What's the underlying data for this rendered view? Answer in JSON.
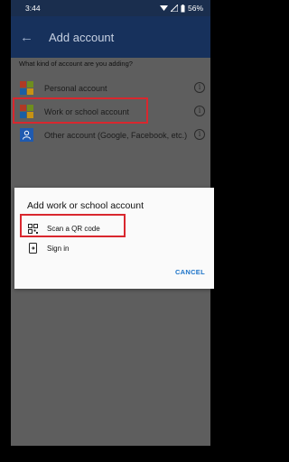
{
  "status_bar": {
    "time": "3:44",
    "battery": "56%"
  },
  "app_bar": {
    "title": "Add account"
  },
  "question": "What kind of account are you adding?",
  "accounts": [
    {
      "label": "Personal account",
      "icon": "microsoft-logo-icon"
    },
    {
      "label": "Work or school account",
      "icon": "microsoft-logo-icon"
    },
    {
      "label": "Other account (Google, Facebook, etc.)",
      "icon": "person-icon"
    }
  ],
  "info_glyph": "i",
  "dialog": {
    "title": "Add work or school account",
    "options": [
      {
        "label": "Scan a QR code",
        "icon": "qr-code-icon"
      },
      {
        "label": "Sign in",
        "icon": "sign-in-phone-icon"
      }
    ],
    "cancel": "CANCEL"
  },
  "colors": {
    "highlight_red": "#d9272e",
    "app_bar": "#17315c",
    "accent": "#1d74c9"
  }
}
